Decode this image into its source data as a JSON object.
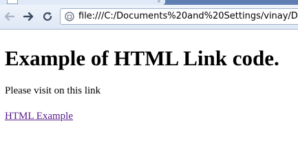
{
  "browser": {
    "url": "file:///C:/Documents%20and%20Settings/vinay/Des"
  },
  "page": {
    "heading": "Example of HTML Link code.",
    "paragraph": "Please visit on this link",
    "link_text": "HTML Example"
  },
  "colors": {
    "link_visited": "#551a8b",
    "toolbar_bg": "#dfe8f5"
  },
  "icons": {
    "back": "back-arrow-icon",
    "forward": "forward-arrow-icon",
    "reload": "reload-icon",
    "page": "page-info-icon"
  }
}
